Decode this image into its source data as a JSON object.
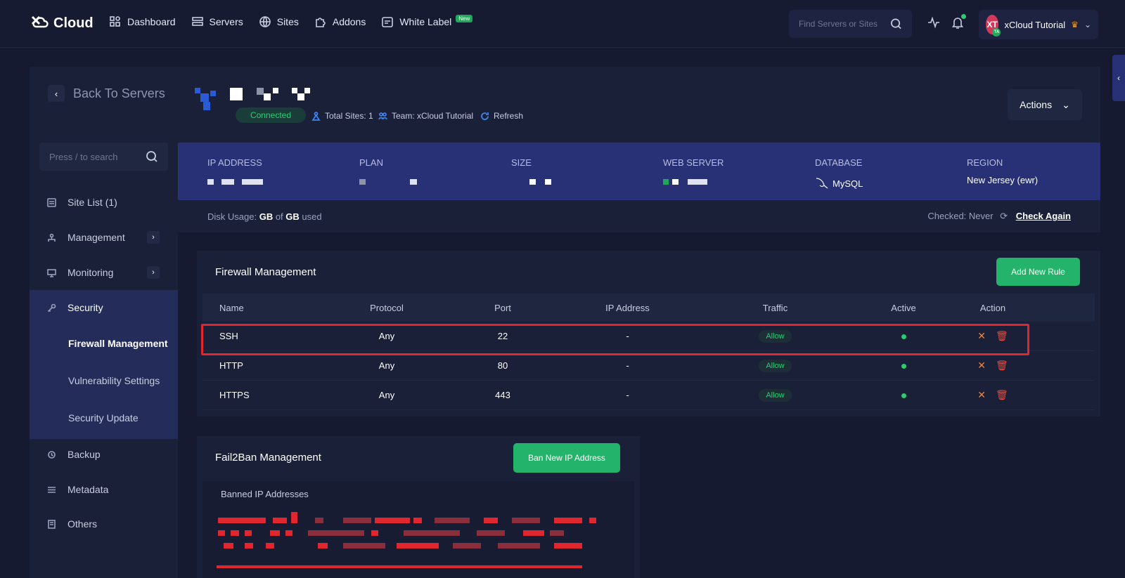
{
  "nav": {
    "logo": "Cloud",
    "links": [
      {
        "label": "Dashboard",
        "icon": "dashboard-icon"
      },
      {
        "label": "Servers",
        "icon": "servers-icon"
      },
      {
        "label": "Sites",
        "icon": "globe-icon"
      },
      {
        "label": "Addons",
        "icon": "puzzle-icon"
      },
      {
        "label": "White Label",
        "icon": "white-label-icon"
      }
    ],
    "new_badge": "New",
    "search_placeholder": "Find Servers or Sites",
    "user": {
      "initials": "XT",
      "sub": "TA",
      "name": "xCloud Tutorial"
    }
  },
  "sidebar": {
    "back": "Back To Servers",
    "search_placeholder": "Press / to search",
    "items": [
      {
        "label": "Site List (1)",
        "icon": "list-icon"
      },
      {
        "label": "Management",
        "icon": "management-icon"
      },
      {
        "label": "Monitoring",
        "icon": "monitor-icon"
      },
      {
        "label": "Security",
        "icon": "key-icon"
      },
      {
        "label": "Backup",
        "icon": "backup-icon"
      },
      {
        "label": "Metadata",
        "icon": "metadata-icon"
      },
      {
        "label": "Others",
        "icon": "others-icon"
      }
    ],
    "security_sub": [
      "Firewall Management",
      "Vulnerability Settings",
      "Security Update"
    ]
  },
  "server": {
    "status": "Connected",
    "total_sites": "Total Sites: 1",
    "team": "Team: xCloud Tutorial",
    "refresh": "Refresh",
    "actions": "Actions",
    "info": {
      "ip_label": "IP ADDRESS",
      "plan_label": "PLAN",
      "size_label": "SIZE",
      "web_label": "WEB SERVER",
      "db_label": "DATABASE",
      "db_value": "MySQL",
      "region_label": "REGION",
      "region_value": "New Jersey (ewr)"
    },
    "disk": {
      "prefix": "Disk Usage:",
      "gb1": "GB",
      "of": "of",
      "gb2": "GB",
      "used": "used"
    },
    "checked": "Checked: Never",
    "check_again": "Check Again"
  },
  "firewall": {
    "title": "Firewall Management",
    "add_button": "Add New Rule",
    "columns": [
      "Name",
      "Protocol",
      "Port",
      "IP Address",
      "Traffic",
      "Active",
      "Action"
    ],
    "rows": [
      {
        "name": "SSH",
        "protocol": "Any",
        "port": "22",
        "ip": "-",
        "traffic": "Allow"
      },
      {
        "name": "HTTP",
        "protocol": "Any",
        "port": "80",
        "ip": "-",
        "traffic": "Allow"
      },
      {
        "name": "HTTPS",
        "protocol": "Any",
        "port": "443",
        "ip": "-",
        "traffic": "Allow"
      }
    ]
  },
  "fail2ban": {
    "title": "Fail2Ban Management",
    "ban_button": "Ban New IP Address",
    "banned_label": "Banned IP Addresses"
  },
  "colors": {
    "accent_green": "#23b36b",
    "info_bar": "#283175",
    "highlight": "#e0262f"
  }
}
